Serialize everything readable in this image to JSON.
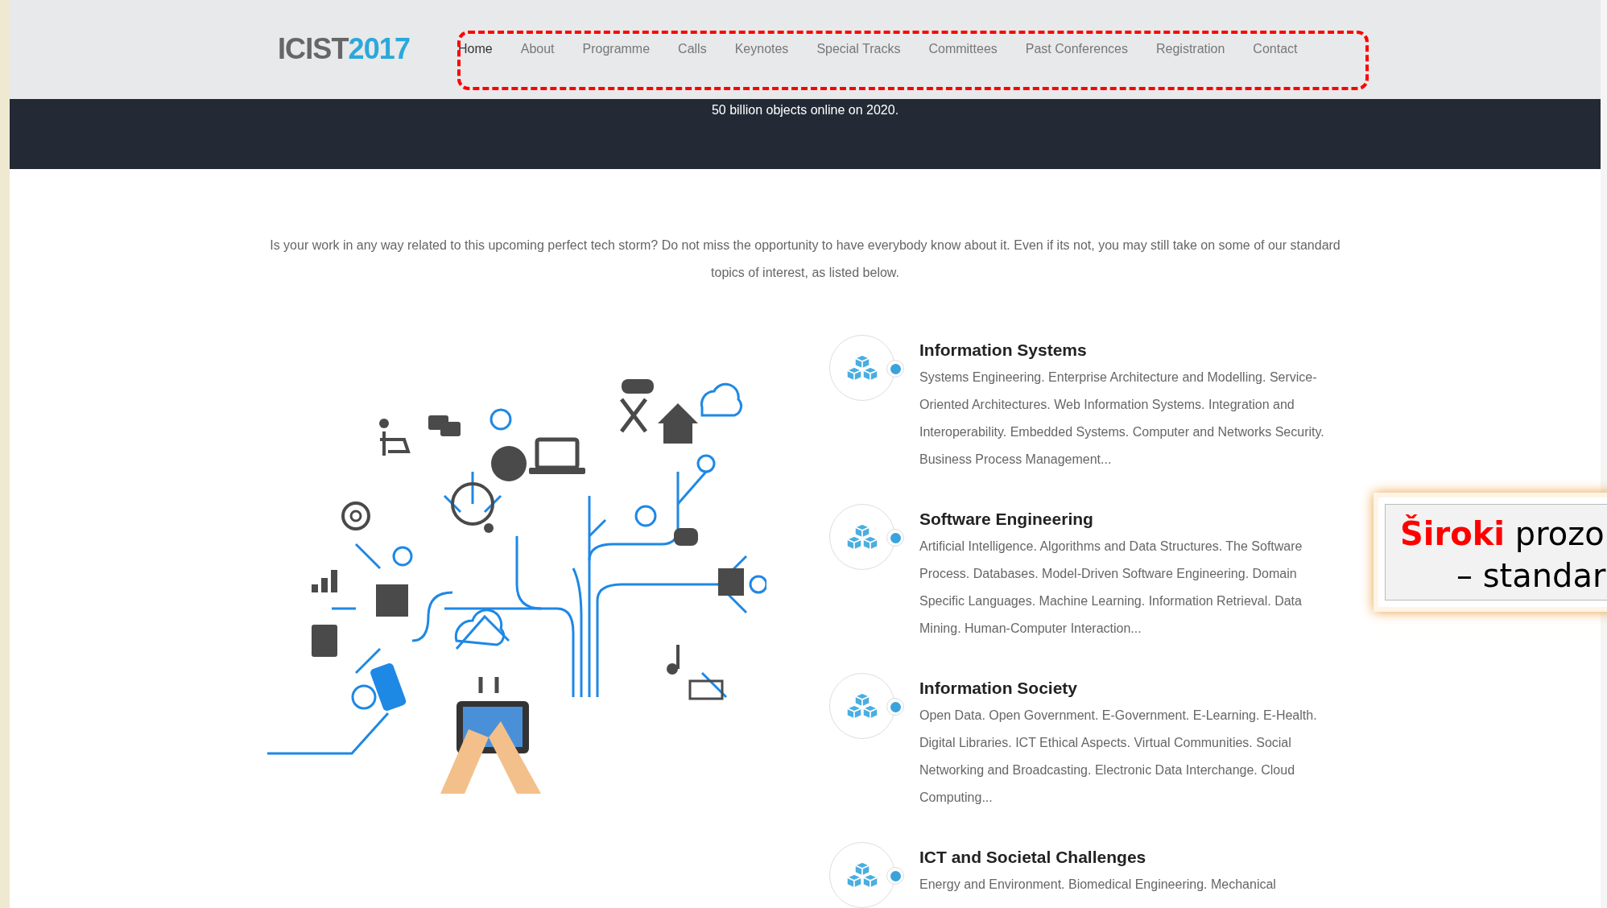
{
  "site": {
    "logo_text": "ICIST",
    "logo_year": "2017"
  },
  "nav": [
    {
      "label": "Home",
      "selected": true
    },
    {
      "label": "About",
      "selected": false
    },
    {
      "label": "Programme",
      "selected": false
    },
    {
      "label": "Calls",
      "selected": false
    },
    {
      "label": "Keynotes",
      "selected": false
    },
    {
      "label": "Special Tracks",
      "selected": false
    },
    {
      "label": "Committees",
      "selected": false
    },
    {
      "label": "Past Conferences",
      "selected": false
    },
    {
      "label": "Registration",
      "selected": false
    },
    {
      "label": "Contact",
      "selected": false
    }
  ],
  "banner": {
    "text": "50 billion objects online on 2020."
  },
  "intro": "Is your work in any way related to this upcoming perfect tech storm? Do not miss the opportunity to have everybody know about it. Even if its not, you may still take on some of our standard topics of interest, as listed below.",
  "topics": [
    {
      "title": "Information Systems",
      "description": "Systems Engineering. Enterprise Architecture and Modelling. Service-Oriented Architectures. Web Information Systems. Integration and Interoperability. Embedded Systems. Computer and Networks Security. Business Process Management..."
    },
    {
      "title": "Software Engineering",
      "description": "Artificial Intelligence. Algorithms and Data Structures. The Software Process. Databases. Model-Driven Software Engineering. Domain Specific Languages. Machine Learning. Information Retrieval. Data Mining. Human-Computer Interaction..."
    },
    {
      "title": "Information Society",
      "description": "Open Data. Open Government. E-Government. E-Learning. E-Health. Digital Libraries. ICT Ethical Aspects. Virtual Communities. Social Networking and Broadcasting. Electronic Data Interchange. Cloud Computing..."
    },
    {
      "title": "ICT and Societal Challenges",
      "description": "Energy and Environment. Biomedical Engineering. Mechanical"
    }
  ],
  "callout": {
    "lines": [
      "**Široki** prozo",
      "– standar"
    ]
  }
}
